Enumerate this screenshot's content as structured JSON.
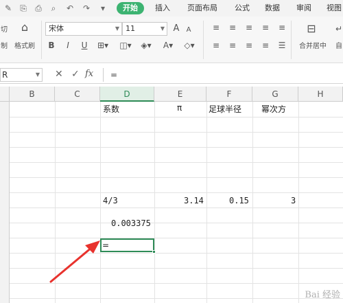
{
  "tabs": {
    "start": "开始",
    "insert": "插入",
    "page_layout": "页面布局",
    "formula": "公式",
    "data": "数据",
    "review": "审阅",
    "view": "视图"
  },
  "ribbon": {
    "cut_label": "切",
    "copy_label": "制",
    "format_painter_label": "格式刷",
    "font_name": "宋体",
    "font_size": "11",
    "merge_center_label": "合并居中",
    "autowrap_label": "自"
  },
  "formula_bar": {
    "name_box": "R",
    "fx_label": "fx",
    "content": "="
  },
  "columns": [
    "B",
    "C",
    "D",
    "E",
    "F",
    "G",
    "H"
  ],
  "cells": {
    "d_header": "系数",
    "e_header": "π",
    "f_header": "足球半径",
    "g_header": "幂次方",
    "d_value": "4/3",
    "e_value": "3.14",
    "f_value": "0.15",
    "g_value": "3",
    "d_result": "0.003375",
    "d_active": "="
  },
  "watermark": "Bai 经验",
  "colors": {
    "accent": "#2e8b57",
    "tab_active": "#3cb371",
    "arrow": "#e8322d"
  }
}
